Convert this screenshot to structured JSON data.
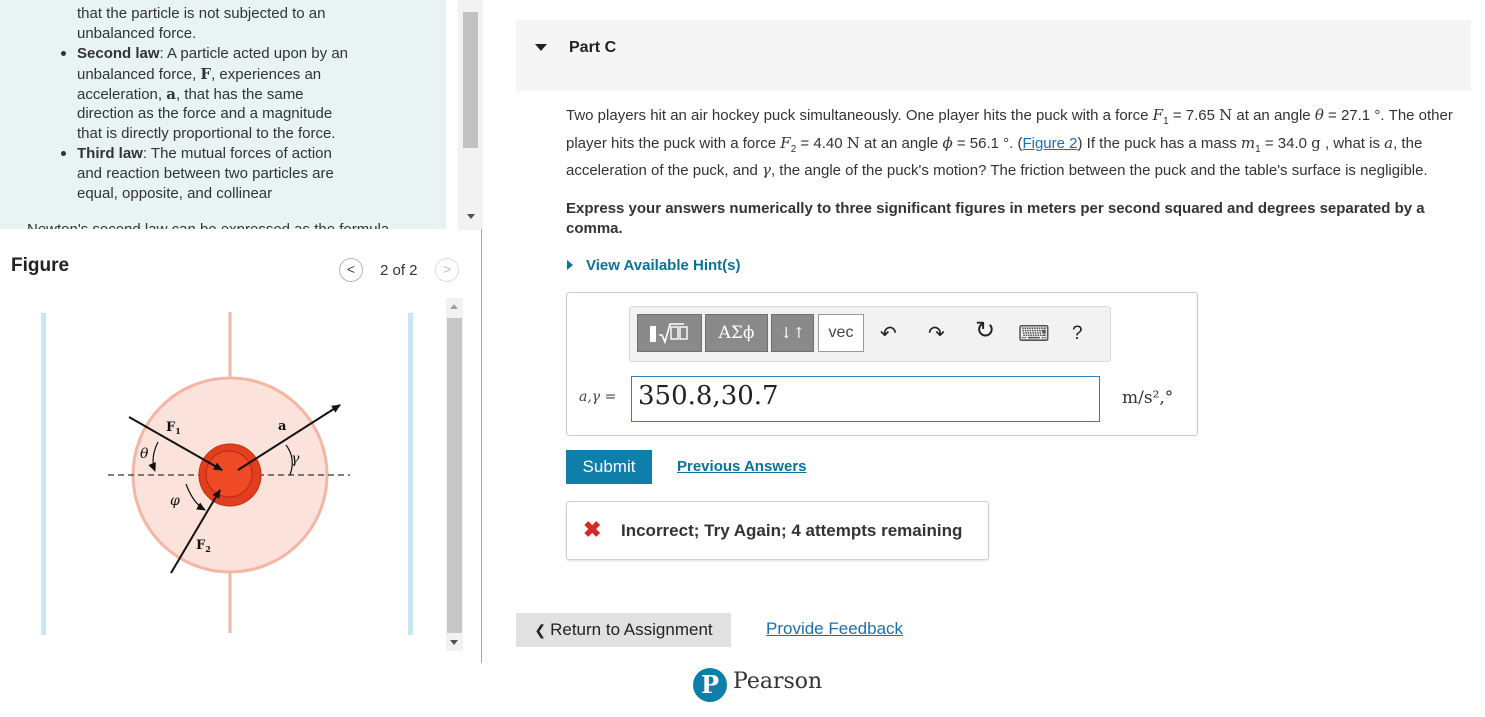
{
  "hint_panel": {
    "line1": "that the particle is not subjected to an",
    "line2": "unbalanced force.",
    "second_law": {
      "label": "Second law",
      "line1_rest": ": A particle acted upon by an",
      "line2a": "unbalanced force, ",
      "line2_sym": "F",
      "line2b": ", experiences an",
      "line3a": "acceleration, ",
      "line3_sym": "a",
      "line3b": ", that has the same",
      "line4": "direction as the force and a magnitude",
      "line5": "that is directly proportional to the force."
    },
    "third_law": {
      "label": "Third law",
      "line1_rest": ": The mutual forces of action",
      "line2": "and reaction between two particles are",
      "line3": "equal, opposite, and collinear"
    },
    "cut_line": "Newton's second law can be expressed as the formula"
  },
  "figure": {
    "label": "Figure",
    "page": "2 of 2",
    "prev": "<",
    "next": ">",
    "labels": {
      "f1": "F",
      "f1_sub": "1",
      "f2": "F",
      "f2_sub": "2",
      "a": "a",
      "gamma": "γ",
      "theta": "θ",
      "phi": "φ"
    }
  },
  "part": {
    "title": "Part C",
    "q_text1": "Two players hit an air hockey puck simultaneously.  One player hits the puck with a force ",
    "q_F1": "F",
    "q_F1_sub": "1",
    "q_text2": " = 7.65 ",
    "q_N": "N",
    "q_text3": " at an angle ",
    "q_theta": "θ",
    "q_text4": " = 27.1 °.",
    "q_text5": " The other player hits the puck with a force ",
    "q_F2": "F",
    "q_F2_sub": "2",
    "q_text6": " = 4.40 ",
    "q_text7": " at an angle ",
    "q_phi": "ϕ",
    "q_text8": " = 56.1 °. (",
    "q_figure_link": "Figure 2",
    "q_text9": ") If the puck has a mass ",
    "q_m": "m",
    "q_m_sub": "1",
    "q_text10": " = 34.0",
    "q_text11": "g",
    "q_text12": " , what is ",
    "q_a": "a",
    "q_text13": ", the acceleration of the puck, and ",
    "q_gamma": "γ",
    "q_text14": ", the angle of the puck's motion?  The friction between the puck and the table's surface is negligible.",
    "instructions": "Express your answers numerically to three significant figures in meters per second squared and degrees separated by a comma.",
    "hints_link": "View Available Hint(s)"
  },
  "toolbar": {
    "greek": "ΑΣϕ",
    "arrows": "↓↑",
    "vec": "vec",
    "undo": "↶",
    "redo": "↷",
    "reset": "↻",
    "keyboard": "⌨",
    "help": "?"
  },
  "answer": {
    "label": "a,γ =",
    "value": "350.8,30.7",
    "units": "m/s²,°"
  },
  "submit_label": "Submit",
  "previous_answers": "Previous Answers",
  "feedback": {
    "icon": "✖",
    "text": "Incorrect; Try Again; 4 attempts remaining"
  },
  "return_label": "Return to Assignment",
  "return_chevron": "❮",
  "provide_feedback": "Provide Feedback",
  "brand": {
    "logo_letter": "P",
    "name": "Pearson"
  }
}
